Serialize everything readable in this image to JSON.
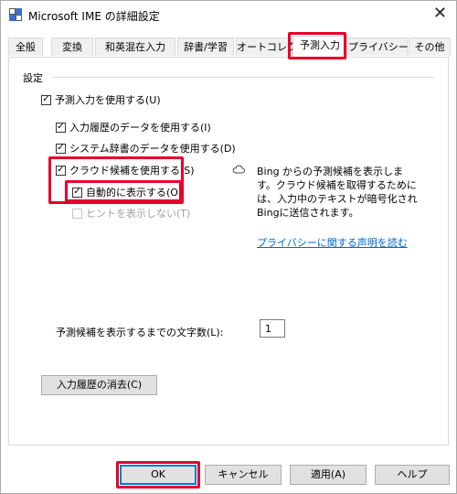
{
  "window": {
    "title": "Microsoft IME の詳細設定",
    "close_glyph": "✕"
  },
  "tabs": [
    {
      "label": "全般",
      "active": false
    },
    {
      "label": "変換",
      "active": false
    },
    {
      "label": "和英混在入力",
      "active": false
    },
    {
      "label": "辞書/学習",
      "active": false
    },
    {
      "label": "オートコレクト",
      "active": false
    },
    {
      "label": "予測入力",
      "active": true
    },
    {
      "label": "プライバシー",
      "active": false
    },
    {
      "label": "その他",
      "active": false
    }
  ],
  "settings": {
    "group_label": "設定",
    "use_prediction": {
      "label": "予測入力を使用する(U)",
      "checked": true
    },
    "use_history": {
      "label": "入力履歴のデータを使用する(I)",
      "checked": true
    },
    "use_system_dict": {
      "label": "システム辞書のデータを使用する(D)",
      "checked": true
    },
    "use_cloud": {
      "label": "クラウド候補を使用する(S)",
      "checked": true
    },
    "auto_show": {
      "label": "自動的に表示する(O)",
      "checked": true
    },
    "hide_hint": {
      "label": "ヒントを表示しない(T)",
      "checked": false,
      "disabled": true
    },
    "cloud_info": "Bing からの予測候補を表示します。クラウド候補を取得するためには、入力中のテキストが暗号化されBingに送信されます。",
    "privacy_link": "プライバシーに関する声明を読む",
    "char_count_label": "予測候補を表示するまでの文字数(L):",
    "char_count_value": "1",
    "clear_history_button": "入力履歴の消去(C)"
  },
  "footer": {
    "ok": "OK",
    "cancel": "キャンセル",
    "apply": "適用(A)",
    "help": "ヘルプ"
  },
  "colors": {
    "highlight": "#e4002b",
    "link": "#0066cc",
    "primary_border": "#0078d7"
  },
  "icons": {
    "app": "ime-settings-icon",
    "cloud": "cloud-icon",
    "close": "close-icon",
    "check": "check-icon"
  }
}
